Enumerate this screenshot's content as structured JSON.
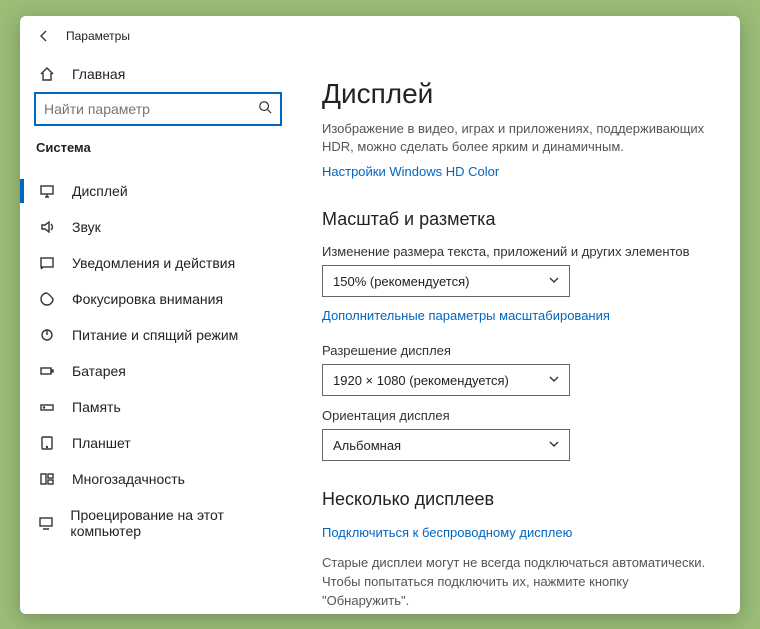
{
  "titlebar": {
    "app_title": "Параметры"
  },
  "sidebar": {
    "home": "Главная",
    "search_placeholder": "Найти параметр",
    "section": "Система",
    "items": [
      {
        "label": "Дисплей"
      },
      {
        "label": "Звук"
      },
      {
        "label": "Уведомления и действия"
      },
      {
        "label": "Фокусировка внимания"
      },
      {
        "label": "Питание и спящий режим"
      },
      {
        "label": "Батарея"
      },
      {
        "label": "Память"
      },
      {
        "label": "Планшет"
      },
      {
        "label": "Многозадачность"
      },
      {
        "label": "Проецирование на этот компьютер"
      }
    ]
  },
  "main": {
    "title": "Дисплей",
    "hdr_desc": "Изображение в видео, играх и приложениях, поддерживающих HDR, можно сделать более ярким и динамичным.",
    "hdr_link": "Настройки Windows HD Color",
    "scale_heading": "Масштаб и разметка",
    "scale_label": "Изменение размера текста, приложений и других элементов",
    "scale_value": "150% (рекомендуется)",
    "scale_link": "Дополнительные параметры масштабирования",
    "res_label": "Разрешение дисплея",
    "res_value": "1920 × 1080 (рекомендуется)",
    "orient_label": "Ориентация дисплея",
    "orient_value": "Альбомная",
    "multi_heading": "Несколько дисплеев",
    "multi_link": "Подключиться к беспроводному дисплею",
    "multi_desc": "Старые дисплеи могут не всегда подключаться автоматически. Чтобы попытаться подключить их, нажмите кнопку \"Обнаружить\"."
  }
}
